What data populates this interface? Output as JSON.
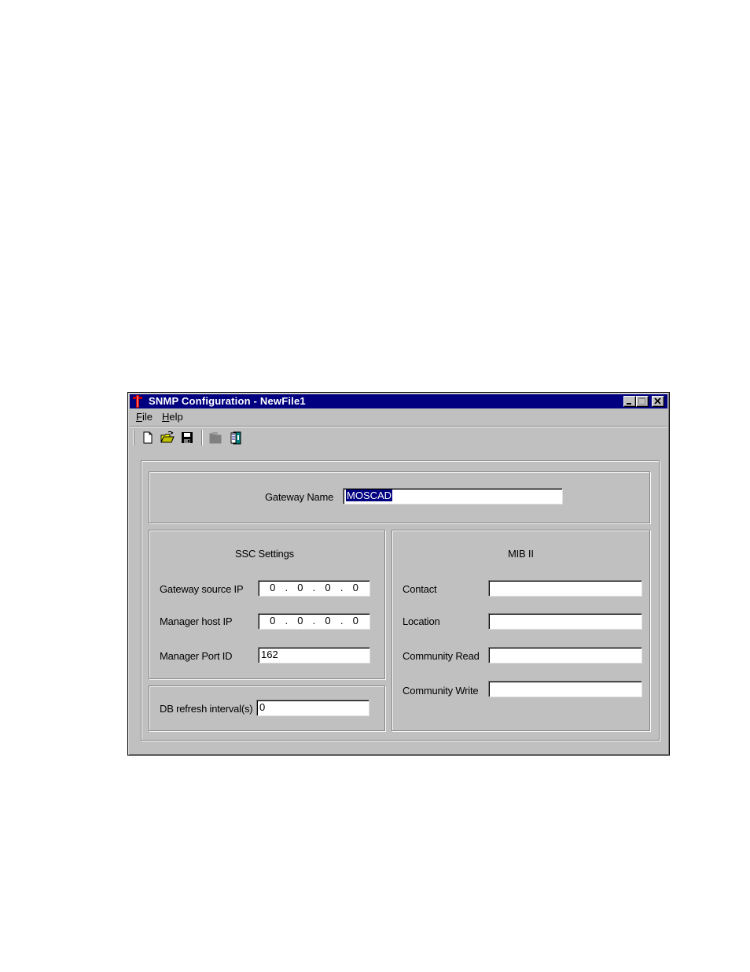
{
  "window": {
    "title": "SNMP Configuration - NewFile1",
    "controls": {
      "minimize": "minimize-icon",
      "maximize": "maximize-icon",
      "close": "close-icon"
    }
  },
  "menu": [
    {
      "label": "File",
      "underline": "F",
      "rest": "ile"
    },
    {
      "label": "Help",
      "underline": "H",
      "rest": "elp"
    }
  ],
  "toolbar": {
    "buttons": [
      {
        "name": "new-file",
        "icon": "new-document-icon",
        "enabled": true
      },
      {
        "name": "open-file",
        "icon": "open-folder-icon",
        "enabled": true
      },
      {
        "name": "save-file",
        "icon": "floppy-disk-icon",
        "enabled": true
      },
      {
        "name": "download",
        "icon": "download-icon",
        "enabled": false
      },
      {
        "name": "about",
        "icon": "book-help-icon",
        "enabled": true
      }
    ]
  },
  "gateway": {
    "label": "Gateway Name",
    "value": "MOSCAD"
  },
  "ssc": {
    "title": "SSC Settings",
    "gateway_source_ip": {
      "label": "Gateway source IP",
      "octets": [
        "0",
        "0",
        "0",
        "0"
      ]
    },
    "manager_host_ip": {
      "label": "Manager host IP",
      "octets": [
        "0",
        "0",
        "0",
        "0"
      ]
    },
    "manager_port_id": {
      "label": "Manager Port ID",
      "value": "162"
    }
  },
  "db_refresh": {
    "label": "DB refresh interval(s)",
    "value": "0"
  },
  "mib": {
    "title": "MIB II",
    "contact": {
      "label": "Contact",
      "value": ""
    },
    "location": {
      "label": "Location",
      "value": ""
    },
    "community_read": {
      "label": "Community Read",
      "value": ""
    },
    "community_write": {
      "label": "Community Write",
      "value": ""
    }
  },
  "colors": {
    "titlebar": "#000080",
    "face": "#c0c0c0",
    "selection": "#000080"
  }
}
